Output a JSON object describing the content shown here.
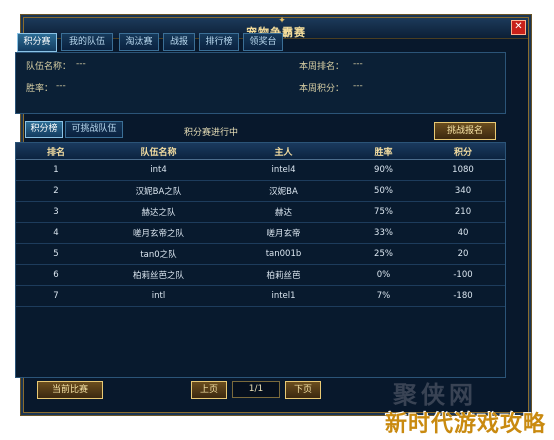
{
  "window": {
    "title": "宠物争霸赛",
    "close_glyph": "✕"
  },
  "tabs": [
    {
      "label": "积分赛",
      "active": true
    },
    {
      "label": "我的队伍",
      "active": false
    },
    {
      "label": "淘汰赛",
      "active": false
    },
    {
      "label": "战报",
      "active": false
    },
    {
      "label": "排行榜",
      "active": false
    },
    {
      "label": "领奖台",
      "active": false
    }
  ],
  "info": {
    "team_name_label": "队伍名称：",
    "team_name_value": "---",
    "weekly_rank_label": "本周排名：",
    "weekly_rank_value": "---",
    "win_rate_label": "胜率：",
    "win_rate_value": "---",
    "weekly_points_label": "本周积分：",
    "weekly_points_value": "---"
  },
  "subtabs": [
    {
      "label": "积分榜",
      "active": true
    },
    {
      "label": "可挑战队伍",
      "active": false
    }
  ],
  "status_text": "积分赛进行中",
  "challenge_button": "挑战报名",
  "table": {
    "headers": [
      "排名",
      "队伍名称",
      "主人",
      "胜率",
      "积分"
    ],
    "rows": [
      [
        "1",
        "int4",
        "intel4",
        "90%",
        "1080"
      ],
      [
        "2",
        "汉妮BA之队",
        "汉妮BA",
        "50%",
        "340"
      ],
      [
        "3",
        "赫达之队",
        "赫达",
        "75%",
        "210"
      ],
      [
        "4",
        "嗟月玄帝之队",
        "嗟月玄帝",
        "33%",
        "40"
      ],
      [
        "5",
        "tan0之队",
        "tan001b",
        "25%",
        "20"
      ],
      [
        "6",
        "柏莉丝芭之队",
        "柏莉丝芭",
        "0%",
        "-100"
      ],
      [
        "7",
        "intl",
        "intel1",
        "7%",
        "-180"
      ]
    ]
  },
  "footer": {
    "current_match": "当前比赛",
    "prev_page": "上页",
    "page_indicator": "1/1",
    "next_page": "下页"
  },
  "watermark": "新时代游戏攻略",
  "watermark_faint": "聚侠网",
  "colors": {
    "frame_bg": "#08182c",
    "gold": "#e8c974",
    "tab_blue": "#3b6f96"
  }
}
